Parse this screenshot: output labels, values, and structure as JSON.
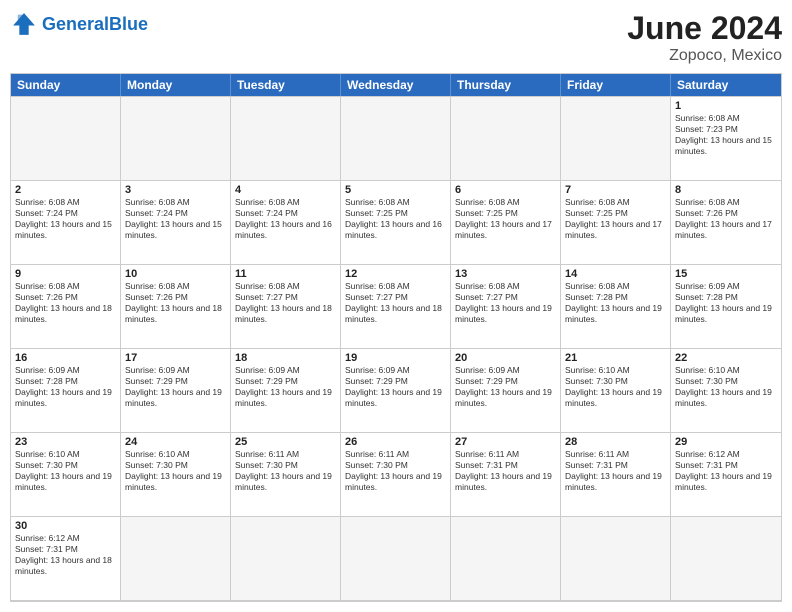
{
  "header": {
    "logo_general": "General",
    "logo_blue": "Blue",
    "month_year": "June 2024",
    "location": "Zopoco, Mexico"
  },
  "day_headers": [
    "Sunday",
    "Monday",
    "Tuesday",
    "Wednesday",
    "Thursday",
    "Friday",
    "Saturday"
  ],
  "cells": [
    {
      "day": "",
      "empty": true,
      "info": ""
    },
    {
      "day": "",
      "empty": true,
      "info": ""
    },
    {
      "day": "",
      "empty": true,
      "info": ""
    },
    {
      "day": "",
      "empty": true,
      "info": ""
    },
    {
      "day": "",
      "empty": true,
      "info": ""
    },
    {
      "day": "",
      "empty": true,
      "info": ""
    },
    {
      "day": "1",
      "empty": false,
      "info": "Sunrise: 6:08 AM\nSunset: 7:23 PM\nDaylight: 13 hours and 15 minutes."
    },
    {
      "day": "2",
      "empty": false,
      "info": "Sunrise: 6:08 AM\nSunset: 7:24 PM\nDaylight: 13 hours and 15 minutes."
    },
    {
      "day": "3",
      "empty": false,
      "info": "Sunrise: 6:08 AM\nSunset: 7:24 PM\nDaylight: 13 hours and 15 minutes."
    },
    {
      "day": "4",
      "empty": false,
      "info": "Sunrise: 6:08 AM\nSunset: 7:24 PM\nDaylight: 13 hours and 16 minutes."
    },
    {
      "day": "5",
      "empty": false,
      "info": "Sunrise: 6:08 AM\nSunset: 7:25 PM\nDaylight: 13 hours and 16 minutes."
    },
    {
      "day": "6",
      "empty": false,
      "info": "Sunrise: 6:08 AM\nSunset: 7:25 PM\nDaylight: 13 hours and 17 minutes."
    },
    {
      "day": "7",
      "empty": false,
      "info": "Sunrise: 6:08 AM\nSunset: 7:25 PM\nDaylight: 13 hours and 17 minutes."
    },
    {
      "day": "8",
      "empty": false,
      "info": "Sunrise: 6:08 AM\nSunset: 7:26 PM\nDaylight: 13 hours and 17 minutes."
    },
    {
      "day": "9",
      "empty": false,
      "info": "Sunrise: 6:08 AM\nSunset: 7:26 PM\nDaylight: 13 hours and 18 minutes."
    },
    {
      "day": "10",
      "empty": false,
      "info": "Sunrise: 6:08 AM\nSunset: 7:26 PM\nDaylight: 13 hours and 18 minutes."
    },
    {
      "day": "11",
      "empty": false,
      "info": "Sunrise: 6:08 AM\nSunset: 7:27 PM\nDaylight: 13 hours and 18 minutes."
    },
    {
      "day": "12",
      "empty": false,
      "info": "Sunrise: 6:08 AM\nSunset: 7:27 PM\nDaylight: 13 hours and 18 minutes."
    },
    {
      "day": "13",
      "empty": false,
      "info": "Sunrise: 6:08 AM\nSunset: 7:27 PM\nDaylight: 13 hours and 19 minutes."
    },
    {
      "day": "14",
      "empty": false,
      "info": "Sunrise: 6:08 AM\nSunset: 7:28 PM\nDaylight: 13 hours and 19 minutes."
    },
    {
      "day": "15",
      "empty": false,
      "info": "Sunrise: 6:09 AM\nSunset: 7:28 PM\nDaylight: 13 hours and 19 minutes."
    },
    {
      "day": "16",
      "empty": false,
      "info": "Sunrise: 6:09 AM\nSunset: 7:28 PM\nDaylight: 13 hours and 19 minutes."
    },
    {
      "day": "17",
      "empty": false,
      "info": "Sunrise: 6:09 AM\nSunset: 7:29 PM\nDaylight: 13 hours and 19 minutes."
    },
    {
      "day": "18",
      "empty": false,
      "info": "Sunrise: 6:09 AM\nSunset: 7:29 PM\nDaylight: 13 hours and 19 minutes."
    },
    {
      "day": "19",
      "empty": false,
      "info": "Sunrise: 6:09 AM\nSunset: 7:29 PM\nDaylight: 13 hours and 19 minutes."
    },
    {
      "day": "20",
      "empty": false,
      "info": "Sunrise: 6:09 AM\nSunset: 7:29 PM\nDaylight: 13 hours and 19 minutes."
    },
    {
      "day": "21",
      "empty": false,
      "info": "Sunrise: 6:10 AM\nSunset: 7:30 PM\nDaylight: 13 hours and 19 minutes."
    },
    {
      "day": "22",
      "empty": false,
      "info": "Sunrise: 6:10 AM\nSunset: 7:30 PM\nDaylight: 13 hours and 19 minutes."
    },
    {
      "day": "23",
      "empty": false,
      "info": "Sunrise: 6:10 AM\nSunset: 7:30 PM\nDaylight: 13 hours and 19 minutes."
    },
    {
      "day": "24",
      "empty": false,
      "info": "Sunrise: 6:10 AM\nSunset: 7:30 PM\nDaylight: 13 hours and 19 minutes."
    },
    {
      "day": "25",
      "empty": false,
      "info": "Sunrise: 6:11 AM\nSunset: 7:30 PM\nDaylight: 13 hours and 19 minutes."
    },
    {
      "day": "26",
      "empty": false,
      "info": "Sunrise: 6:11 AM\nSunset: 7:30 PM\nDaylight: 13 hours and 19 minutes."
    },
    {
      "day": "27",
      "empty": false,
      "info": "Sunrise: 6:11 AM\nSunset: 7:31 PM\nDaylight: 13 hours and 19 minutes."
    },
    {
      "day": "28",
      "empty": false,
      "info": "Sunrise: 6:11 AM\nSunset: 7:31 PM\nDaylight: 13 hours and 19 minutes."
    },
    {
      "day": "29",
      "empty": false,
      "info": "Sunrise: 6:12 AM\nSunset: 7:31 PM\nDaylight: 13 hours and 19 minutes."
    },
    {
      "day": "30",
      "empty": false,
      "info": "Sunrise: 6:12 AM\nSunset: 7:31 PM\nDaylight: 13 hours and 18 minutes."
    },
    {
      "day": "",
      "empty": true,
      "info": ""
    },
    {
      "day": "",
      "empty": true,
      "info": ""
    },
    {
      "day": "",
      "empty": true,
      "info": ""
    },
    {
      "day": "",
      "empty": true,
      "info": ""
    },
    {
      "day": "",
      "empty": true,
      "info": ""
    },
    {
      "day": "",
      "empty": true,
      "info": ""
    }
  ]
}
